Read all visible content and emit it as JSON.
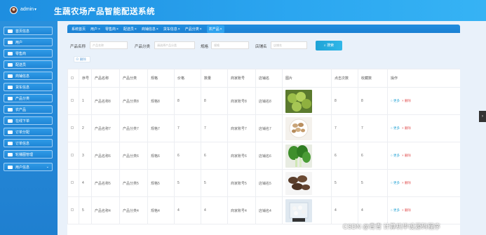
{
  "header": {
    "user": "admin",
    "caret": "▾",
    "title": "生蔬农场产品智能配送系统"
  },
  "sidebar": {
    "items": [
      {
        "label": "首页信息"
      },
      {
        "label": "用户"
      },
      {
        "label": "零售商"
      },
      {
        "label": "配送员"
      },
      {
        "label": "商铺信息"
      },
      {
        "label": "货车信息"
      },
      {
        "label": "产品分类"
      },
      {
        "label": "农产品"
      },
      {
        "label": "在线下单"
      },
      {
        "label": "订单分配"
      },
      {
        "label": "订单信息"
      },
      {
        "label": "轮播图管理"
      },
      {
        "label": "用户信息"
      }
    ]
  },
  "tabs": [
    {
      "label": "系统首页",
      "closable": false
    },
    {
      "label": "用户",
      "closable": true
    },
    {
      "label": "零售商",
      "closable": true
    },
    {
      "label": "配送员",
      "closable": true
    },
    {
      "label": "商铺信息",
      "closable": true
    },
    {
      "label": "货车信息",
      "closable": true
    },
    {
      "label": "产品分类",
      "closable": true
    },
    {
      "label": "农产品",
      "closable": true,
      "active": true
    }
  ],
  "tab_close": "×",
  "search": {
    "name_label": "产品名称",
    "name_placeholder": "产品名称",
    "category_label": "产品分类",
    "category_placeholder": "请选择产品分类",
    "spec_label": "规格",
    "spec_placeholder": "规格",
    "shop_label": "店铺名",
    "shop_placeholder": "店铺名",
    "button": "搜索"
  },
  "delete_button": "删除",
  "table": {
    "columns": [
      "",
      "序号",
      "产品名称",
      "产品分类",
      "规格",
      "价格",
      "数量",
      "商家账号",
      "店铺名",
      "图片",
      "点击次数",
      "收藏数",
      "操作"
    ],
    "rows": [
      {
        "no": "1",
        "name": "产品名称8",
        "category": "产品分类8",
        "spec": "规格8",
        "price": "8",
        "qty": "8",
        "merchant": "商家账号8",
        "shop": "店铺名8",
        "img": "olives",
        "clicks": "8",
        "favs": "8"
      },
      {
        "no": "2",
        "name": "产品名称7",
        "category": "产品分类7",
        "spec": "规格7",
        "price": "7",
        "qty": "7",
        "merchant": "商家账号7",
        "shop": "店铺名7",
        "img": "mushrooms",
        "clicks": "7",
        "favs": "7"
      },
      {
        "no": "3",
        "name": "产品名称6",
        "category": "产品分类6",
        "spec": "规格6",
        "price": "6",
        "qty": "6",
        "merchant": "商家账号6",
        "shop": "店铺名6",
        "img": "greens",
        "clicks": "6",
        "favs": "6"
      },
      {
        "no": "4",
        "name": "产品名称5",
        "category": "产品分类5",
        "spec": "规格5",
        "price": "5",
        "qty": "5",
        "merchant": "商家账号5",
        "shop": "店铺名5",
        "img": "shiitake",
        "clicks": "5",
        "favs": "5"
      },
      {
        "no": "5",
        "name": "产品名称4",
        "category": "产品分类4",
        "spec": "规格4",
        "price": "4",
        "qty": "4",
        "merchant": "商家账号4",
        "shop": "店铺名4",
        "img": "package",
        "clicks": "4",
        "favs": "4"
      }
    ],
    "edit_label": "更多",
    "delete_label": "删除"
  },
  "right_tab": "›",
  "watermark": "CSDN @青青  计算机毕设源码程序",
  "colors": {
    "topbar": "#2ba6f0",
    "sidebar": "#1f7fd0",
    "search_button": "#1ea3d6",
    "delete_red": "#e25757"
  }
}
